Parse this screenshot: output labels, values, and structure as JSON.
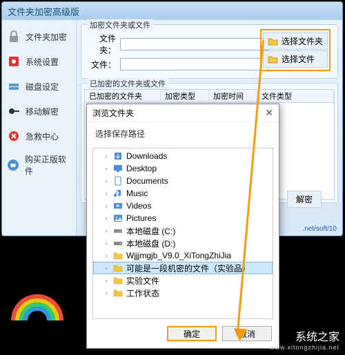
{
  "window": {
    "title": "文件夹加密高级版"
  },
  "sidebar": {
    "items": [
      {
        "label": "文件夹加密"
      },
      {
        "label": "系统设置"
      },
      {
        "label": "磁盘设定"
      },
      {
        "label": "移动解密"
      },
      {
        "label": "急救中心"
      },
      {
        "label": "购买正版软件"
      }
    ]
  },
  "encrypt": {
    "group": "加密文件夹或文件",
    "folder_label": "文件夹：",
    "file_label": "文件：",
    "browse_folder": "选择文件夹",
    "browse_file": "选择文件"
  },
  "table": {
    "group": "已加密的文件夹或文件",
    "cols": [
      "已加密的文件夹",
      "加密类型",
      "加密时间",
      "文件类型"
    ]
  },
  "decrypt_label": "解密",
  "footer": ".net/soft/10",
  "dialog": {
    "title": "浏览文件夹",
    "subtitle": "选择保存路径",
    "ok": "确定",
    "cancel": "取消",
    "items": [
      {
        "label": "Downloads",
        "icon": "down"
      },
      {
        "label": "Desktop",
        "icon": "desktop"
      },
      {
        "label": "Documents",
        "icon": "doc"
      },
      {
        "label": "Music",
        "icon": "music"
      },
      {
        "label": "Videos",
        "icon": "video"
      },
      {
        "label": "Pictures",
        "icon": "pic"
      },
      {
        "label": "本地磁盘 (C:)",
        "icon": "drive"
      },
      {
        "label": "本地磁盘 (D:)",
        "icon": "drive"
      },
      {
        "label": "Wjjjmgjb_V9.0_XiTongZhiJia",
        "icon": "folder"
      },
      {
        "label": "可能是一段机密的文件（实验品）",
        "icon": "folder",
        "selected": true
      },
      {
        "label": "实验文件",
        "icon": "folder"
      },
      {
        "label": "工作状态",
        "icon": "folder"
      }
    ]
  },
  "brand": {
    "name": "系统之家",
    "sub": "www.xitongzhijia.net"
  }
}
